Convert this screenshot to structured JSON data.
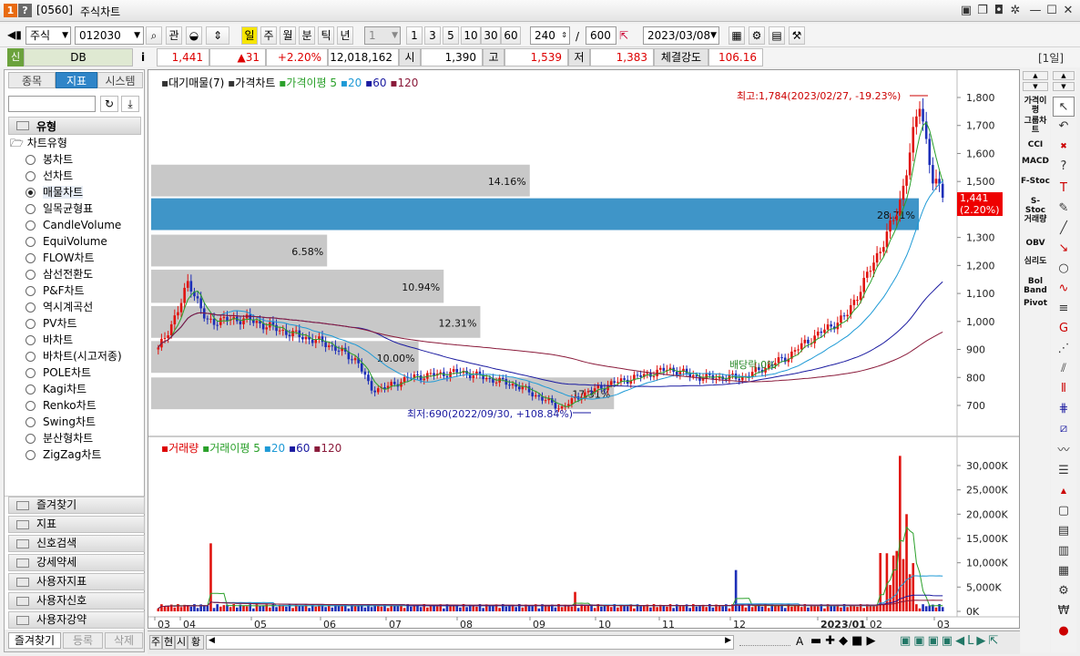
{
  "title": {
    "code": "[0560]",
    "name": "주식차트",
    "icon1": "1",
    "icon2": "?"
  },
  "toolbar": {
    "market": "주식",
    "code": "012030",
    "btn_kwan": "관",
    "periods": [
      "일",
      "주",
      "월",
      "분",
      "틱",
      "년"
    ],
    "period_active": "일",
    "interval_value": "1",
    "intervals": [
      "1",
      "3",
      "5",
      "10",
      "30",
      "60"
    ],
    "count": "240",
    "slash": "/",
    "total": "600",
    "date": "2023/03/08"
  },
  "quote": {
    "badge": "신",
    "name": "DB",
    "info": "i",
    "price": "1,441",
    "change": "▲31",
    "rate": "+2.20%",
    "volume": "12,018,162",
    "open_label": "시",
    "open": "1,390",
    "high_label": "고",
    "high": "1,539",
    "low_label": "저",
    "low": "1,383",
    "strength_label": "체결강도",
    "strength": "106.16",
    "period_tag": "[1일]"
  },
  "left": {
    "tabs": [
      "종목",
      "지표",
      "시스템"
    ],
    "active_tab": "지표",
    "section": "유형",
    "chart_types_title": "차트유형",
    "chart_types": [
      "봉차트",
      "선차트",
      "매물차트",
      "일목균형표",
      "CandleVolume",
      "EquiVolume",
      "FLOW차트",
      "삼선전환도",
      "P&F차트",
      "역시계곡선",
      "PV차트",
      "바차트",
      "바차트(시고저종)",
      "POLE차트",
      "Kagi차트",
      "Renko차트",
      "Swing차트",
      "분산형차트",
      "ZigZag차트"
    ],
    "selected": "매물차트",
    "categories": [
      "즐겨찾기",
      "지표",
      "신호검색",
      "강세약세",
      "사용자지표",
      "사용자신호",
      "사용자강약"
    ],
    "bottom_tabs": [
      "즐겨찾기",
      "등록",
      "삭제"
    ]
  },
  "price_chart": {
    "legend": [
      "대기매물(7)",
      "가격차트",
      "가격이평 5",
      "20",
      "60",
      "120"
    ],
    "high_note": "최고:1,784(2023/02/27, -19.23%)",
    "low_note": "최저:690(2022/09/30, +108.84%)",
    "dividend_note": "배당락:0%",
    "current": "1,441",
    "current_rate": "(2.20%)",
    "y_ticks": [
      "1,800",
      "1,700",
      "1,600",
      "1,500",
      "1,400",
      "1,300",
      "1,200",
      "1,100",
      "1,000",
      "900",
      "800",
      "700"
    ],
    "profile": [
      {
        "label": "14.16%",
        "value": 14.16
      },
      {
        "label": "28.71%",
        "value": 28.71
      },
      {
        "label": "6.58%",
        "value": 6.58
      },
      {
        "label": "10.94%",
        "value": 10.94
      },
      {
        "label": "12.31%",
        "value": 12.31
      },
      {
        "label": "10.00%",
        "value": 10.0
      },
      {
        "label": "17.31%",
        "value": 17.31
      }
    ],
    "colors": {
      "up": "#e0140f",
      "down": "#1d2fb8",
      "ma5": "#2aa02a",
      "ma20": "#1e9ad6",
      "ma60": "#1a1aa0",
      "ma120": "#8a1a3a",
      "profile": "#c8c8c8",
      "profile_hi": "#3f95c8"
    }
  },
  "volume_chart": {
    "legend": [
      "거래량",
      "거래이평 5",
      "20",
      "60",
      "120"
    ],
    "y_ticks": [
      "30,000K",
      "25,000K",
      "20,000K",
      "15,000K",
      "10,000K",
      "5,000K",
      "0K"
    ]
  },
  "x_axis": [
    "03",
    "04",
    "05",
    "06",
    "07",
    "08",
    "09",
    "10",
    "11",
    "12",
    "2023/01",
    "02",
    "03"
  ],
  "status": {
    "buttons": [
      "주",
      "현",
      "시",
      "황"
    ],
    "font_a": "A"
  },
  "right_toolbar": [
    "가격이평",
    "그룹차트",
    "CCI",
    "MACD",
    "F-Stoc",
    "S-Stoc",
    "거래량",
    "OBV",
    "심리도",
    "Bol Band",
    "Pivot"
  ]
}
